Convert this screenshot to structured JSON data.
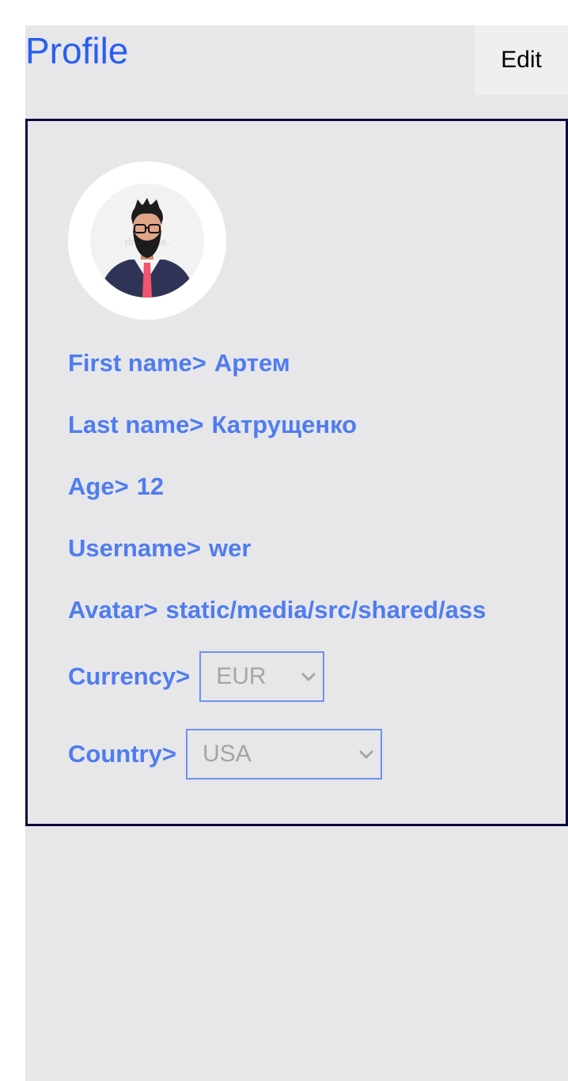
{
  "header": {
    "title": "Profile",
    "edit_label": "Edit"
  },
  "profile": {
    "avatar_icon": "user-avatar",
    "avatar_watermark": "dre... ine.",
    "fields": {
      "first_name": {
        "label": "First name>",
        "value": "Артем"
      },
      "last_name": {
        "label": "Last name>",
        "value": "Катрущенко"
      },
      "age": {
        "label": "Age>",
        "value": "12"
      },
      "username": {
        "label": "Username>",
        "value": "wer"
      },
      "avatar": {
        "label": "Avatar>",
        "value": "static/media/src/shared/ass"
      },
      "currency": {
        "label": "Currency>",
        "value": "EUR"
      },
      "country": {
        "label": "Country>",
        "value": "USA"
      }
    }
  },
  "colors": {
    "accent": "#2a5ef0",
    "field_text": "#4f7cef",
    "card_border": "#0b0a3d",
    "page_background": "#e7e7ea",
    "select_border": "#6c93ef",
    "select_text": "#a5a5a8"
  }
}
